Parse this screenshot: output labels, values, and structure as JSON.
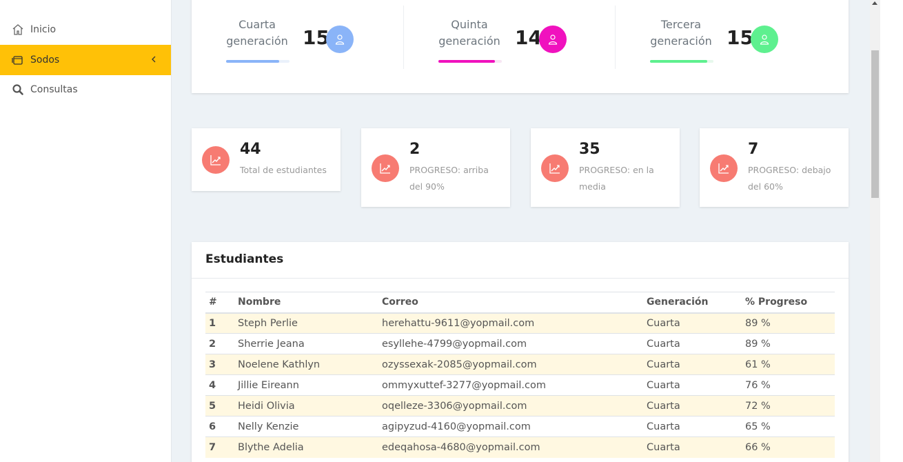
{
  "sidebar": {
    "items": [
      {
        "label": "Inicio",
        "icon": "home-icon",
        "active": false
      },
      {
        "label": "Sodos",
        "icon": "folder-icon",
        "active": true
      },
      {
        "label": "Consultas",
        "icon": "search-icon",
        "active": false
      }
    ]
  },
  "generations": [
    {
      "label_line1": "Cuarta",
      "label_line2": "generación",
      "count": "15",
      "color": "#8ab4f8",
      "bar_bg": "#eaf1fb",
      "progress": 0.84
    },
    {
      "label_line1": "Quinta",
      "label_line2": "generación",
      "count": "14",
      "color": "#f012be",
      "bar_bg": "#f7e6f3",
      "progress": 0.89
    },
    {
      "label_line1": "Tercera",
      "label_line2": "generación",
      "count": "15",
      "color": "#5ef08f",
      "bar_bg": "#e6f8ec",
      "progress": 0.9
    }
  ],
  "stats": [
    {
      "value": "44",
      "label": "Total de estudiantes"
    },
    {
      "value": "2",
      "label": "PROGRESO: arriba del 90%"
    },
    {
      "value": "35",
      "label": "PROGRESO: en la media"
    },
    {
      "value": "7",
      "label": "PROGRESO: debajo del 60%"
    }
  ],
  "students": {
    "title": "Estudiantes",
    "headers": [
      "#",
      "Nombre",
      "Correo",
      "Generación",
      "% Progreso"
    ],
    "rows": [
      {
        "num": "1",
        "name": "Steph Perlie",
        "email": "herehattu-9611@yopmail.com",
        "gen": "Cuarta",
        "progress": "89 %"
      },
      {
        "num": "2",
        "name": "Sherrie Jeana",
        "email": "esyllehe-4799@yopmail.com",
        "gen": "Cuarta",
        "progress": "89 %"
      },
      {
        "num": "3",
        "name": "Noelene Kathlyn",
        "email": "ozyssexak-2085@yopmail.com",
        "gen": "Cuarta",
        "progress": "61 %"
      },
      {
        "num": "4",
        "name": "Jillie Eireann",
        "email": "ommyxuttef-3277@yopmail.com",
        "gen": "Cuarta",
        "progress": "76 %"
      },
      {
        "num": "5",
        "name": "Heidi Olivia",
        "email": "oqelleze-3306@yopmail.com",
        "gen": "Cuarta",
        "progress": "72 %"
      },
      {
        "num": "6",
        "name": "Nelly Kenzie",
        "email": "agipyzud-4160@yopmail.com",
        "gen": "Cuarta",
        "progress": "65 %"
      },
      {
        "num": "7",
        "name": "Blythe Adelia",
        "email": "edeqahosa-4680@yopmail.com",
        "gen": "Cuarta",
        "progress": "66 %"
      }
    ]
  },
  "colors": {
    "accent": "#ffc107",
    "stat_icon": "#f77b72",
    "row_highlight": "#fff8e1"
  }
}
